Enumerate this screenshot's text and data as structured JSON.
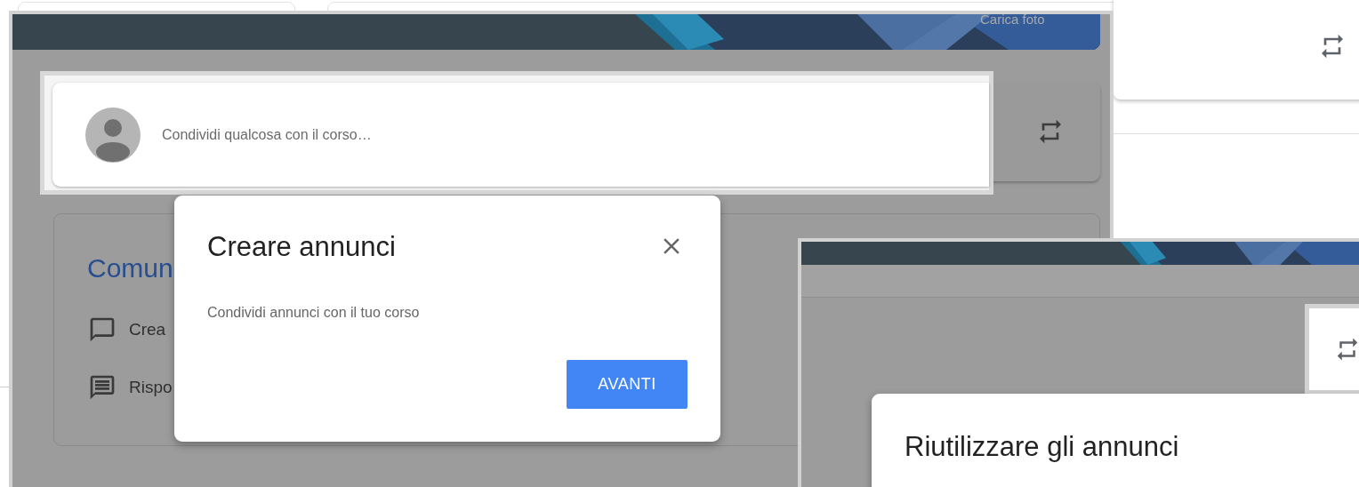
{
  "screenshots": [
    {
      "kind": "stream",
      "banner_button": "Carica foto",
      "composer": {
        "placeholder": "Condividi qualcosa con il corso…"
      },
      "card": {
        "title": "Comun",
        "items": [
          {
            "kind": "comment",
            "label": "Crea"
          },
          {
            "kind": "feedback",
            "label": "Rispo"
          }
        ]
      },
      "dialog": {
        "title": "Creare annunci",
        "text": "Condividi annunci con il tuo corso",
        "button": "AVANTI"
      }
    },
    {
      "kind": "reuse",
      "dialog": {
        "title": "Riutilizzare gli annunci"
      }
    }
  ]
}
